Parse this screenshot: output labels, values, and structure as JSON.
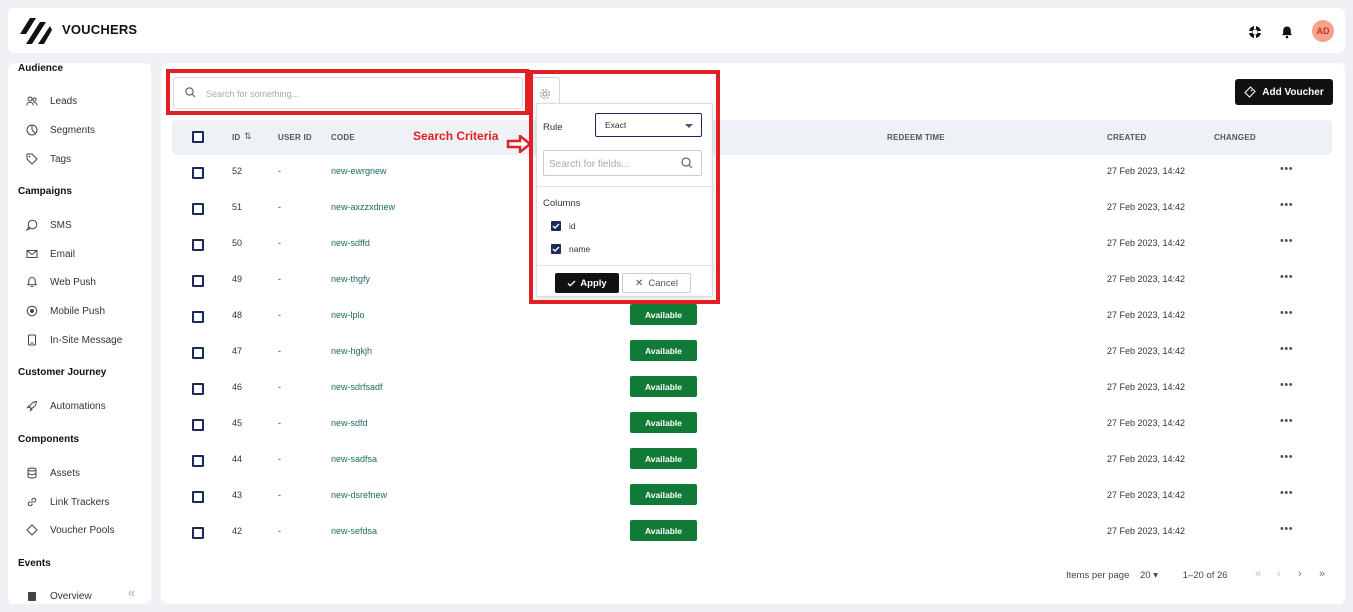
{
  "app": {
    "title": "VOUCHERS",
    "avatar_initials": "AD"
  },
  "sidebar": {
    "sections": [
      {
        "title": "Audience",
        "items": [
          "Leads",
          "Segments",
          "Tags"
        ]
      },
      {
        "title": "Campaigns",
        "items": [
          "SMS",
          "Email",
          "Web Push",
          "Mobile Push",
          "In-Site Message"
        ]
      },
      {
        "title": "Customer Journey",
        "items": [
          "Automations"
        ]
      },
      {
        "title": "Components",
        "items": [
          "Assets",
          "Link Trackers",
          "Voucher Pools"
        ]
      },
      {
        "title": "Events",
        "items": [
          "Overview"
        ]
      }
    ]
  },
  "search": {
    "placeholder": "Search for something..."
  },
  "add_button": {
    "label": "Add Voucher"
  },
  "table": {
    "headers": {
      "id": "ID",
      "user_id": "USER ID",
      "code": "CODE",
      "redeem_time": "REDEEM TIME",
      "created": "CREATED",
      "changed": "CHANGED"
    },
    "rows": [
      {
        "id": "52",
        "user_id": "-",
        "code": "new-ewrgnew",
        "status": "",
        "created": "27 Feb 2023, 14:42"
      },
      {
        "id": "51",
        "user_id": "-",
        "code": "new-axzzxdnew",
        "status": "",
        "created": "27 Feb 2023, 14:42"
      },
      {
        "id": "50",
        "user_id": "-",
        "code": "new-sdffd",
        "status": "",
        "created": "27 Feb 2023, 14:42"
      },
      {
        "id": "49",
        "user_id": "-",
        "code": "new-thgfy",
        "status": "",
        "created": "27 Feb 2023, 14:42"
      },
      {
        "id": "48",
        "user_id": "-",
        "code": "new-lplo",
        "status": "Available",
        "created": "27 Feb 2023, 14:42"
      },
      {
        "id": "47",
        "user_id": "-",
        "code": "new-hgkjh",
        "status": "Available",
        "created": "27 Feb 2023, 14:42"
      },
      {
        "id": "46",
        "user_id": "-",
        "code": "new-sdrfsadf",
        "status": "Available",
        "created": "27 Feb 2023, 14:42"
      },
      {
        "id": "45",
        "user_id": "-",
        "code": "new-sdfd",
        "status": "Available",
        "created": "27 Feb 2023, 14:42"
      },
      {
        "id": "44",
        "user_id": "-",
        "code": "new-sadfsa",
        "status": "Available",
        "created": "27 Feb 2023, 14:42"
      },
      {
        "id": "43",
        "user_id": "-",
        "code": "new-dsrefnew",
        "status": "Available",
        "created": "27 Feb 2023, 14:42"
      },
      {
        "id": "42",
        "user_id": "-",
        "code": "new-sefdsa",
        "status": "Available",
        "created": "27 Feb 2023, 14:42"
      }
    ]
  },
  "pagination": {
    "items_per_page_label": "Items per page",
    "items_per_page": "20",
    "range": "1–20 of 26"
  },
  "annotation": {
    "label": "Search Criteria",
    "color": "#e02024"
  },
  "popup": {
    "rule_label": "Rule",
    "rule_value": "Exact",
    "field_search_placeholder": "Search for fields...",
    "columns_label": "Columns",
    "columns": [
      {
        "name": "id",
        "checked": true
      },
      {
        "name": "name",
        "checked": true
      }
    ],
    "apply_label": "Apply",
    "cancel_label": "Cancel"
  },
  "colors": {
    "status_green": "#117a36",
    "code_text": "#1d6b63",
    "checkbox_navy": "#1b2a5a"
  }
}
